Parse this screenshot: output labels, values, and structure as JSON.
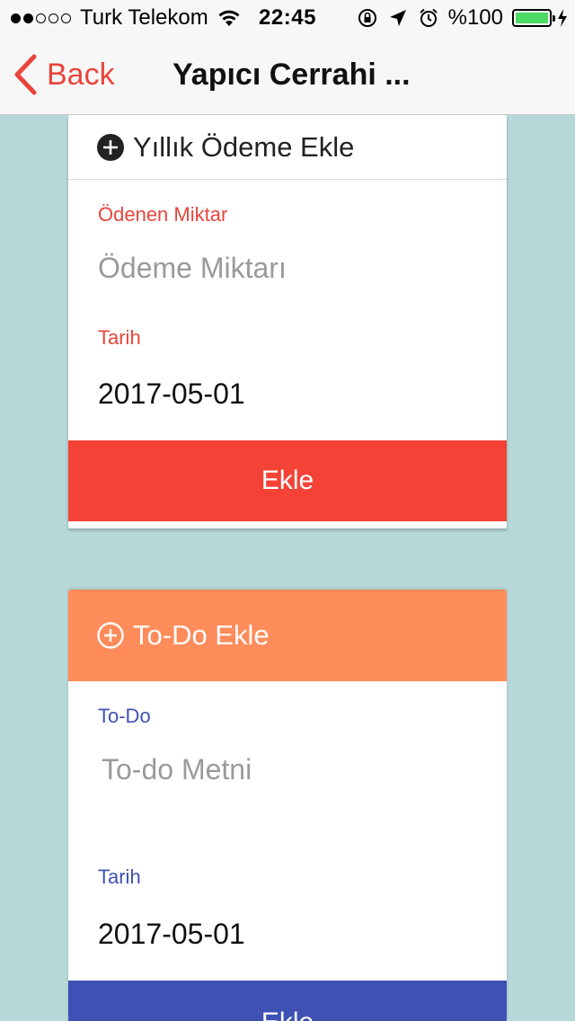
{
  "status_bar": {
    "carrier": "Turk Telekom",
    "time": "22:45",
    "battery_percent": "%100",
    "signal_bars_filled": 2,
    "signal_bars_total": 5,
    "icons": [
      "wifi-icon",
      "rotation-lock-icon",
      "location-arrow-icon",
      "alarm-icon",
      "battery-icon",
      "charging-icon"
    ]
  },
  "nav": {
    "back_label": "Back",
    "title": "Yapıcı Cerrahi ..."
  },
  "yearly_payment_card": {
    "header_title": "Yıllık Ödeme Ekle",
    "header_icon": "plus-circle-icon",
    "amount_label": "Ödenen Miktar",
    "amount_placeholder": "Ödeme Miktarı",
    "amount_value": "",
    "date_label": "Tarih",
    "date_value": "2017-05-01",
    "submit_label": "Ekle"
  },
  "todo_card": {
    "header_title": "To-Do Ekle",
    "header_icon": "plus-circle-icon",
    "todo_label": "To-Do",
    "todo_placeholder": "To-do Metni",
    "todo_value": "",
    "date_label": "Tarih",
    "date_value": "2017-05-01",
    "submit_label": "Ekle"
  },
  "colors": {
    "background": "#b6d8d8",
    "accent_red": "#f44336",
    "back_red": "#e8453c",
    "todo_header_orange": "#ff8c5a",
    "todo_blue": "#3f51b5"
  }
}
